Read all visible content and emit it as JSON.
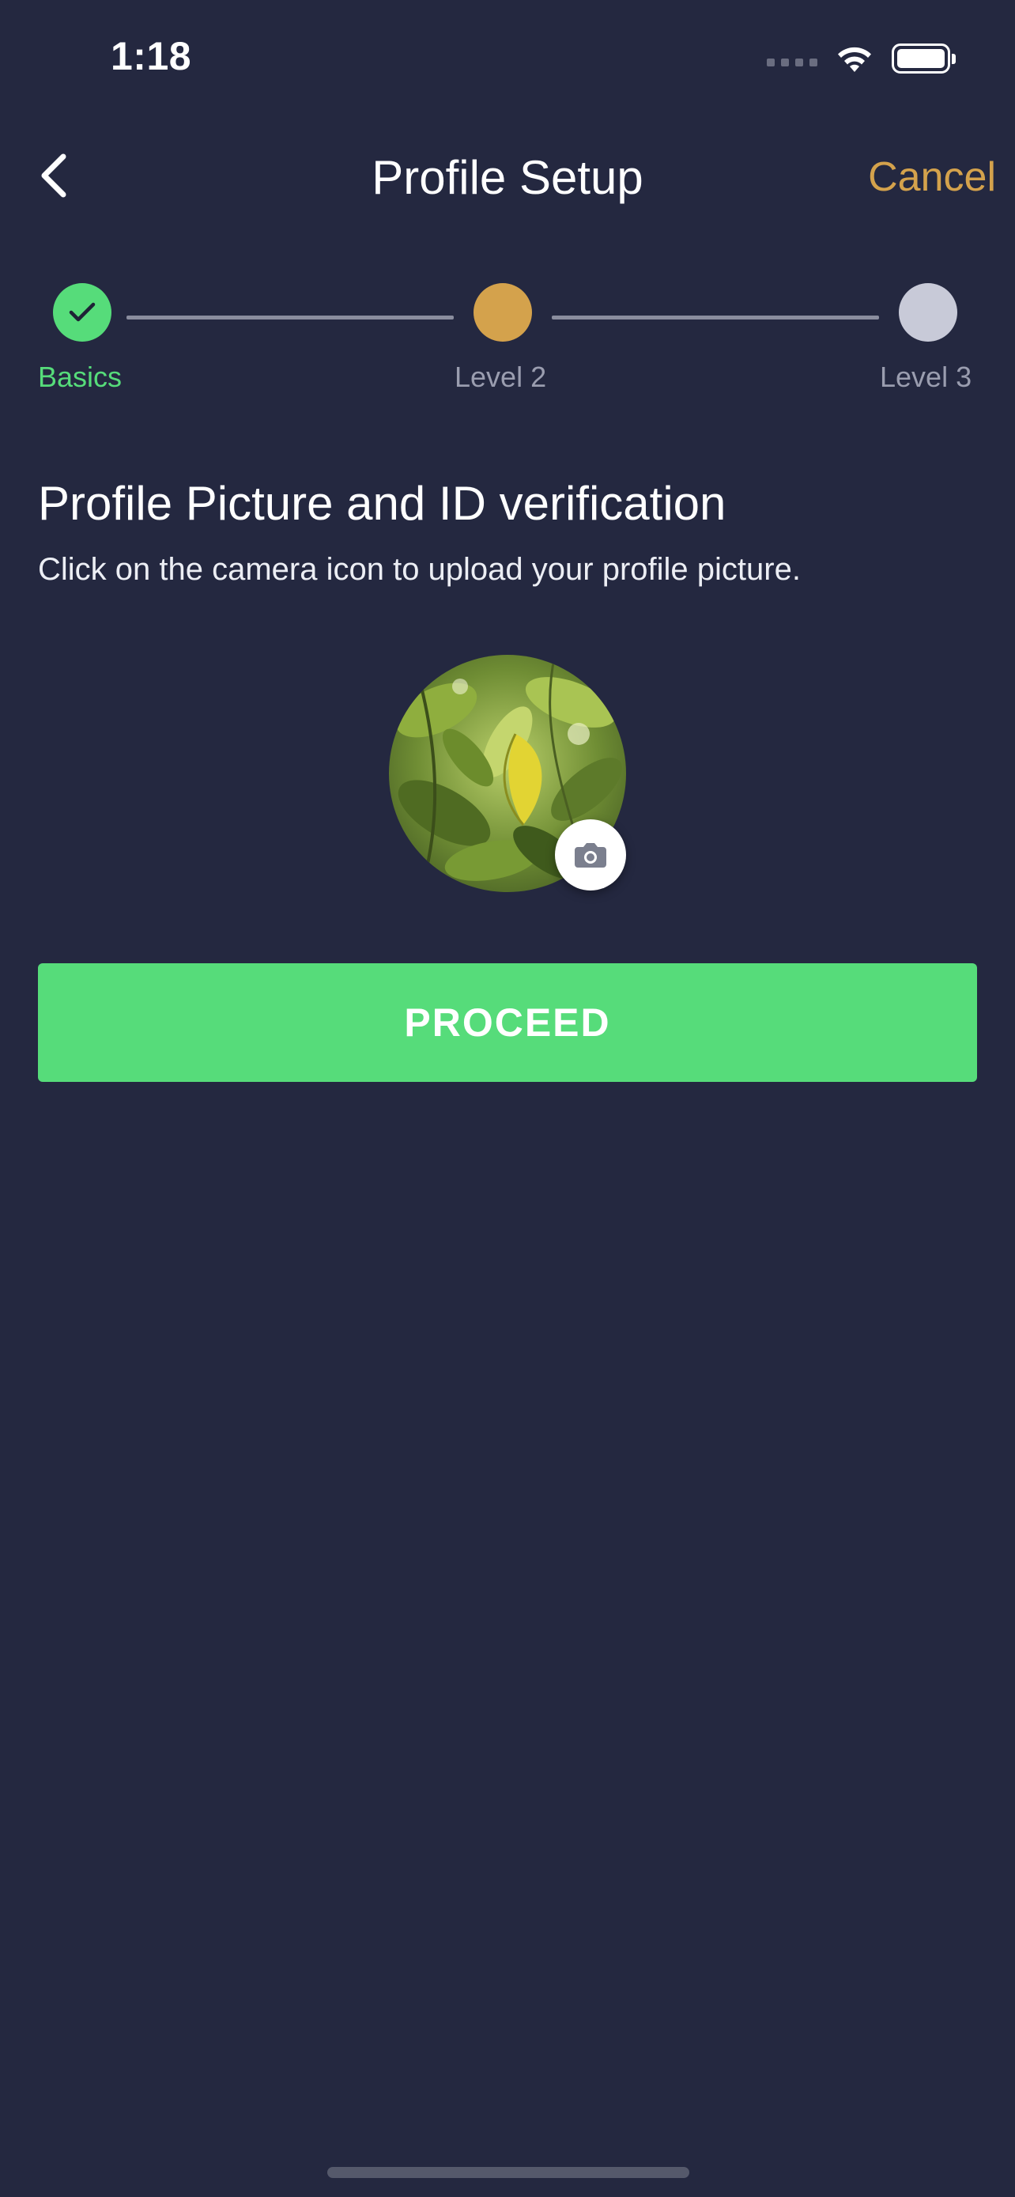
{
  "status_bar": {
    "time": "1:18",
    "icons": [
      "cellular-signal-icon",
      "wifi-icon",
      "battery-icon"
    ]
  },
  "header": {
    "back_icon": "chevron-left-icon",
    "title": "Profile Setup",
    "cancel_label": "Cancel"
  },
  "stepper": {
    "steps": [
      {
        "label": "Basics",
        "state": "completed",
        "icon": "checkmark-icon"
      },
      {
        "label": "Level 2",
        "state": "current"
      },
      {
        "label": "Level 3",
        "state": "upcoming"
      }
    ]
  },
  "section": {
    "heading": "Profile Picture and ID verification",
    "description": "Click on the camera icon to upload your profile picture."
  },
  "avatar": {
    "icon": "camera-icon"
  },
  "actions": {
    "proceed_label": "PROCEED"
  },
  "colors": {
    "background": "#242840",
    "accent_green": "#56dc7a",
    "accent_gold": "#d4a24c",
    "step_upcoming": "#c8cad8",
    "muted_text": "#9a9daf"
  }
}
